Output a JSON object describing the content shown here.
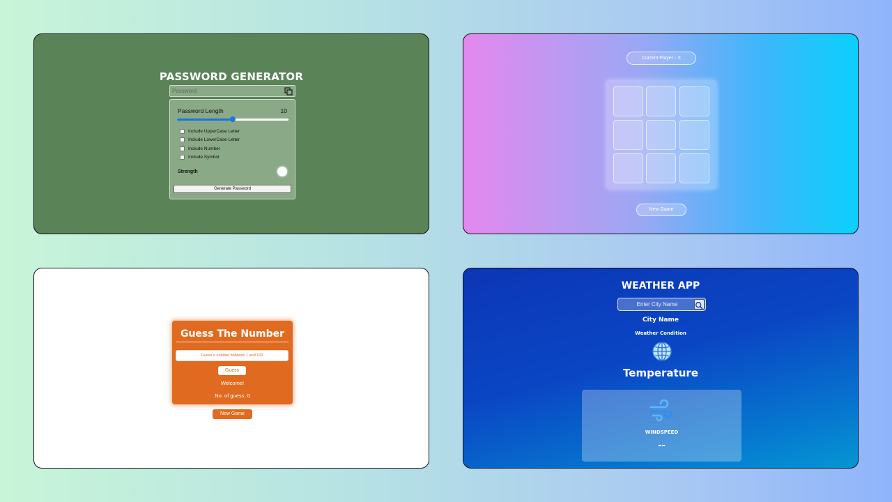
{
  "colors": {
    "password_bg": "#5a8358",
    "password_card": "#8aa986",
    "slider_accent": "#1a73e8",
    "guess_orange": "#e06b20",
    "weather_blue": "#0c36b6"
  },
  "password_generator": {
    "title": "PASSWORD GENERATOR",
    "password_placeholder": "Password",
    "copy_icon": "copy-icon",
    "length_label": "Password Length",
    "length_value": "10",
    "slider_level": 0.5,
    "options": [
      "Include UpperCase Letter",
      "Include LowerCase Letter",
      "Include Number",
      "Include Symbol"
    ],
    "strength_label": "Strength",
    "generate_label": "Generate Password"
  },
  "tic_tac_toe": {
    "status": "Current Player - X",
    "new_game_label": "New Game"
  },
  "guess_number": {
    "title": "Guess The Number",
    "input_placeholder": "Guess a number between 1 and 100",
    "guess_label": "Guess",
    "message": "Welcome!",
    "count_text": "No. of guess: 0",
    "new_game_label": "New Game"
  },
  "weather": {
    "title": "WEATHER APP",
    "search_placeholder": "Enter City Name",
    "search_icon": "search-icon",
    "city": "City Name",
    "condition": "Weather Condition",
    "condition_icon": "globe-icon",
    "temperature": "Temperature",
    "wind_icon": "wind-icon",
    "wind_label": "WINDSPEED",
    "wind_value": "--"
  }
}
